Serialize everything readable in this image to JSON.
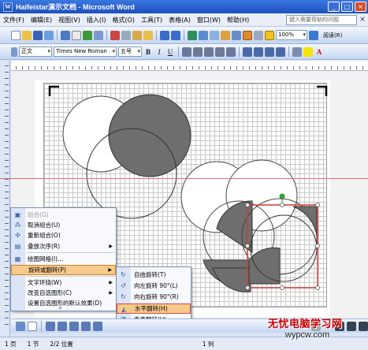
{
  "window": {
    "title": "Haifeistar演示文档 - Microsoft Word",
    "app_icon": "W"
  },
  "menubar": {
    "items": [
      "文件(F)",
      "编辑(E)",
      "视图(V)",
      "插入(I)",
      "格式(O)",
      "工具(T)",
      "表格(A)",
      "窗口(W)",
      "帮助(H)"
    ],
    "help_placeholder": "键入需要帮助的问题",
    "close_glyph": "×"
  },
  "standard_toolbar": {
    "zoom": "100%",
    "read_button": "阅读(R)"
  },
  "formatting_toolbar": {
    "style": "正文",
    "font": "Times New Roman",
    "size": "五号",
    "bold": "B",
    "italic": "I",
    "underline": "U",
    "font_color_glyph": "A"
  },
  "context_menu": {
    "items": [
      {
        "label": "组合(G)",
        "icon": "group-icon",
        "disabled": true
      },
      {
        "label": "取消组合(U)",
        "icon": "ungroup-icon",
        "disabled": false
      },
      {
        "label": "重新组合(O)",
        "icon": "regroup-icon",
        "disabled": false
      },
      {
        "label": "叠放次序(R)",
        "icon": "order-icon",
        "disabled": false,
        "submenu": true
      },
      {
        "label": "绘图网格(I)...",
        "icon": "grid-icon",
        "disabled": false
      },
      {
        "label": "旋转或翻转(P)",
        "icon": "",
        "disabled": false,
        "submenu": true,
        "highlighted": true
      },
      {
        "label": "文字环绕(W)",
        "icon": "",
        "disabled": false,
        "submenu": true
      },
      {
        "label": "改变自选图形(C)",
        "icon": "",
        "disabled": false,
        "submenu": true
      },
      {
        "label": "设置自选图形的默认效果(D)",
        "icon": "",
        "disabled": false
      }
    ],
    "expand_glyph": "»"
  },
  "submenu": {
    "items": [
      {
        "label": "自由旋转(T)",
        "icon": "free-rotate-icon"
      },
      {
        "label": "向左旋转 90°(L)",
        "icon": "rotate-left-icon"
      },
      {
        "label": "向右旋转 90°(R)",
        "icon": "rotate-right-icon"
      },
      {
        "label": "水平翻转(H)",
        "icon": "flip-horizontal-icon",
        "highlighted": true
      },
      {
        "label": "垂直翻转(V)",
        "icon": "flip-vertical-icon"
      }
    ]
  },
  "drawing_toolbar": {
    "font_color_glyph": "A"
  },
  "statusbar": {
    "page": "1 页",
    "section": "1 节",
    "position": "2/2 位置",
    "line": "1 列"
  },
  "watermark": {
    "line1": "无忧电脑学习网",
    "line2": "wypcw.com"
  },
  "colors": {
    "title_bar": "#1c4fbd",
    "menu_highlight": "#f7c98a",
    "selection_box": "#d23c3c",
    "shaded_fill": "#6e6e6e",
    "watermark_red": "#cc0000"
  }
}
